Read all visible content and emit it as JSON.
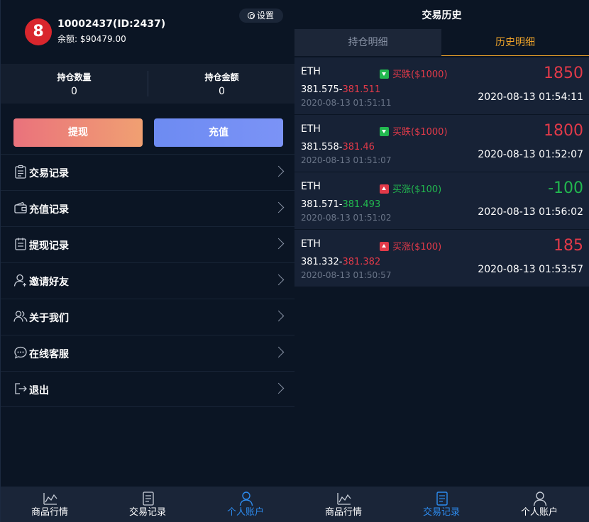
{
  "left": {
    "profile": {
      "avatar_logo": "8",
      "username": "10002437(ID:2437)",
      "balance_label": "余额:",
      "balance_value": "$90479.00",
      "settings_label": "设置"
    },
    "stats": [
      {
        "label": "持仓数量",
        "value": "0"
      },
      {
        "label": "持仓金额",
        "value": "0"
      }
    ],
    "buttons": {
      "withdraw": "提现",
      "deposit": "充值",
      "withdraw_color": "#ea727c",
      "deposit_color": "#6d8bf2"
    },
    "menu": [
      {
        "label": "交易记录",
        "icon": "clipboard-icon"
      },
      {
        "label": "充值记录",
        "icon": "wallet-icon"
      },
      {
        "label": "提现记录",
        "icon": "list-icon"
      },
      {
        "label": "邀请好友",
        "icon": "user-add-icon"
      },
      {
        "label": "关于我们",
        "icon": "users-icon"
      },
      {
        "label": "在线客服",
        "icon": "chat-icon"
      },
      {
        "label": "退出",
        "icon": "logout-icon"
      }
    ],
    "nav": [
      {
        "label": "商品行情",
        "icon": "chart-icon",
        "active": false
      },
      {
        "label": "交易记录",
        "icon": "document-icon",
        "active": false
      },
      {
        "label": "个人账户",
        "icon": "user-icon",
        "active": true
      }
    ]
  },
  "right": {
    "title": "交易历史",
    "tabs": [
      {
        "label": "持仓明细",
        "active": false
      },
      {
        "label": "历史明细",
        "active": true
      }
    ],
    "trades": [
      {
        "symbol": "ETH",
        "direction": "买跌",
        "amount": "($1000)",
        "type": "down",
        "profit": "1850",
        "profit_color": "red",
        "open_price": "381.575",
        "close_price": "381.511",
        "close_color": "red",
        "open_time": "2020-08-13 01:51:11",
        "close_time": "2020-08-13 01:54:11"
      },
      {
        "symbol": "ETH",
        "direction": "买跌",
        "amount": "($1000)",
        "type": "down",
        "profit": "1800",
        "profit_color": "red",
        "open_price": "381.558",
        "close_price": "381.46",
        "close_color": "red",
        "open_time": "2020-08-13 01:51:07",
        "close_time": "2020-08-13 01:52:07"
      },
      {
        "symbol": "ETH",
        "direction": "买涨",
        "amount": "($100)",
        "type": "up",
        "profit": "-100",
        "profit_color": "green",
        "open_price": "381.571",
        "close_price": "381.493",
        "close_color": "green",
        "open_time": "2020-08-13 01:51:02",
        "close_time": "2020-08-13 01:56:02"
      },
      {
        "symbol": "ETH",
        "direction": "买涨",
        "amount": "($100)",
        "type": "up",
        "profit": "185",
        "profit_color": "red",
        "open_price": "381.332",
        "close_price": "381.382",
        "close_color": "red",
        "open_time": "2020-08-13 01:50:57",
        "close_time": "2020-08-13 01:53:57"
      }
    ],
    "nav": [
      {
        "label": "商品行情",
        "icon": "chart-icon",
        "active": false
      },
      {
        "label": "交易记录",
        "icon": "document-icon",
        "active": true
      },
      {
        "label": "个人账户",
        "icon": "user-icon",
        "active": false
      }
    ]
  }
}
